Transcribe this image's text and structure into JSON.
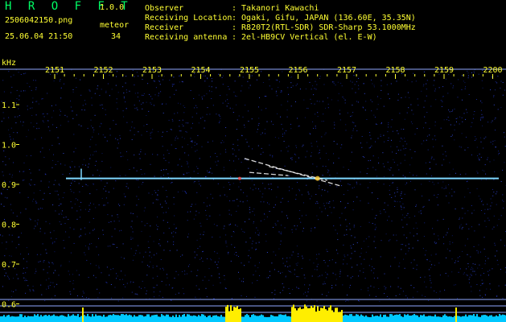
{
  "app": {
    "name": "H R O F F T",
    "version": "1.0.0",
    "filename": "2506042150.png",
    "datetime": "25.06.04 21:50",
    "meteor_label": "meteor",
    "meteor_count": "34"
  },
  "station": [
    {
      "label": "Observer",
      "value": ": Takanori Kawachi"
    },
    {
      "label": "Receiving Location",
      "value": ": Ogaki, Gifu, JAPAN (136.60E, 35.35N)"
    },
    {
      "label": "Receiver",
      "value": ": R820T2(RTL-SDR) SDR-Sharp 53.1000MHz"
    },
    {
      "label": "Receiving antenna",
      "value": ": 2el-HB9CV Vertical (el. E-W)"
    }
  ],
  "colors": {
    "label": "#ffff33",
    "logo": "#00ff66",
    "background": "#000000",
    "noise": "#1a2a9a",
    "carrier": "#7fd8ff",
    "echo": "#ffffff",
    "frame": "#8fa8ff",
    "bottom_noise": "#00c8ff",
    "bottom_peak": "#ffee00"
  },
  "chart_data": {
    "type": "heatmap",
    "x_unit_label": "",
    "y_unit_label": "kHz",
    "x_ticks": [
      "2151",
      "2152",
      "2153",
      "2154",
      "2155",
      "2156",
      "2157",
      "2158",
      "2159",
      "2200"
    ],
    "y_ticks": [
      "1.1",
      "1.0",
      "0.9",
      "0.8",
      "0.7",
      "0.6"
    ],
    "carrier_khz": 0.915,
    "echoes": [
      {
        "t_start": 2154.9,
        "t_end": 2156.9,
        "f_start": 0.965,
        "f_end": 0.895
      },
      {
        "t_start": 2155.4,
        "t_end": 2156.6,
        "f_start": 0.945,
        "f_end": 0.91
      },
      {
        "t_start": 2155.0,
        "t_end": 2155.8,
        "f_start": 0.93,
        "f_end": 0.922
      }
    ]
  }
}
